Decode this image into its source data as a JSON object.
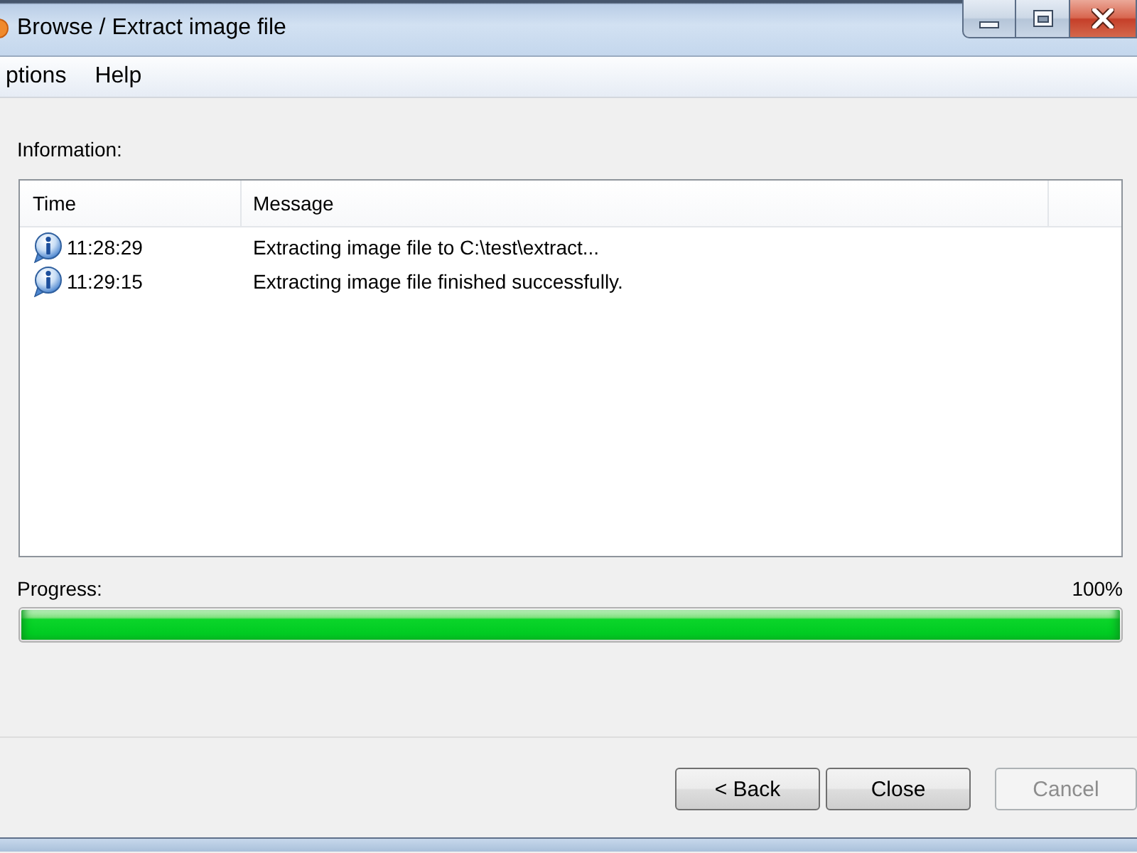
{
  "window": {
    "title": "Browse / Extract image file"
  },
  "menu": [
    {
      "label": "ptions"
    },
    {
      "label": "Help"
    }
  ],
  "information": {
    "label": "Information:",
    "columns": [
      "Time",
      "Message"
    ],
    "rows": [
      {
        "kind": "info",
        "time": "11:28:29",
        "message": "Extracting image file to C:\\test\\extract..."
      },
      {
        "kind": "info",
        "time": "11:29:15",
        "message": "Extracting image file finished successfully."
      }
    ]
  },
  "progress": {
    "label": "Progress:",
    "percent": "100%",
    "level": 1
  },
  "buttons": [
    {
      "label": "< Back",
      "disabled": false
    },
    {
      "label": "Close",
      "disabled": false
    },
    {
      "label": "Cancel",
      "disabled": true
    }
  ]
}
